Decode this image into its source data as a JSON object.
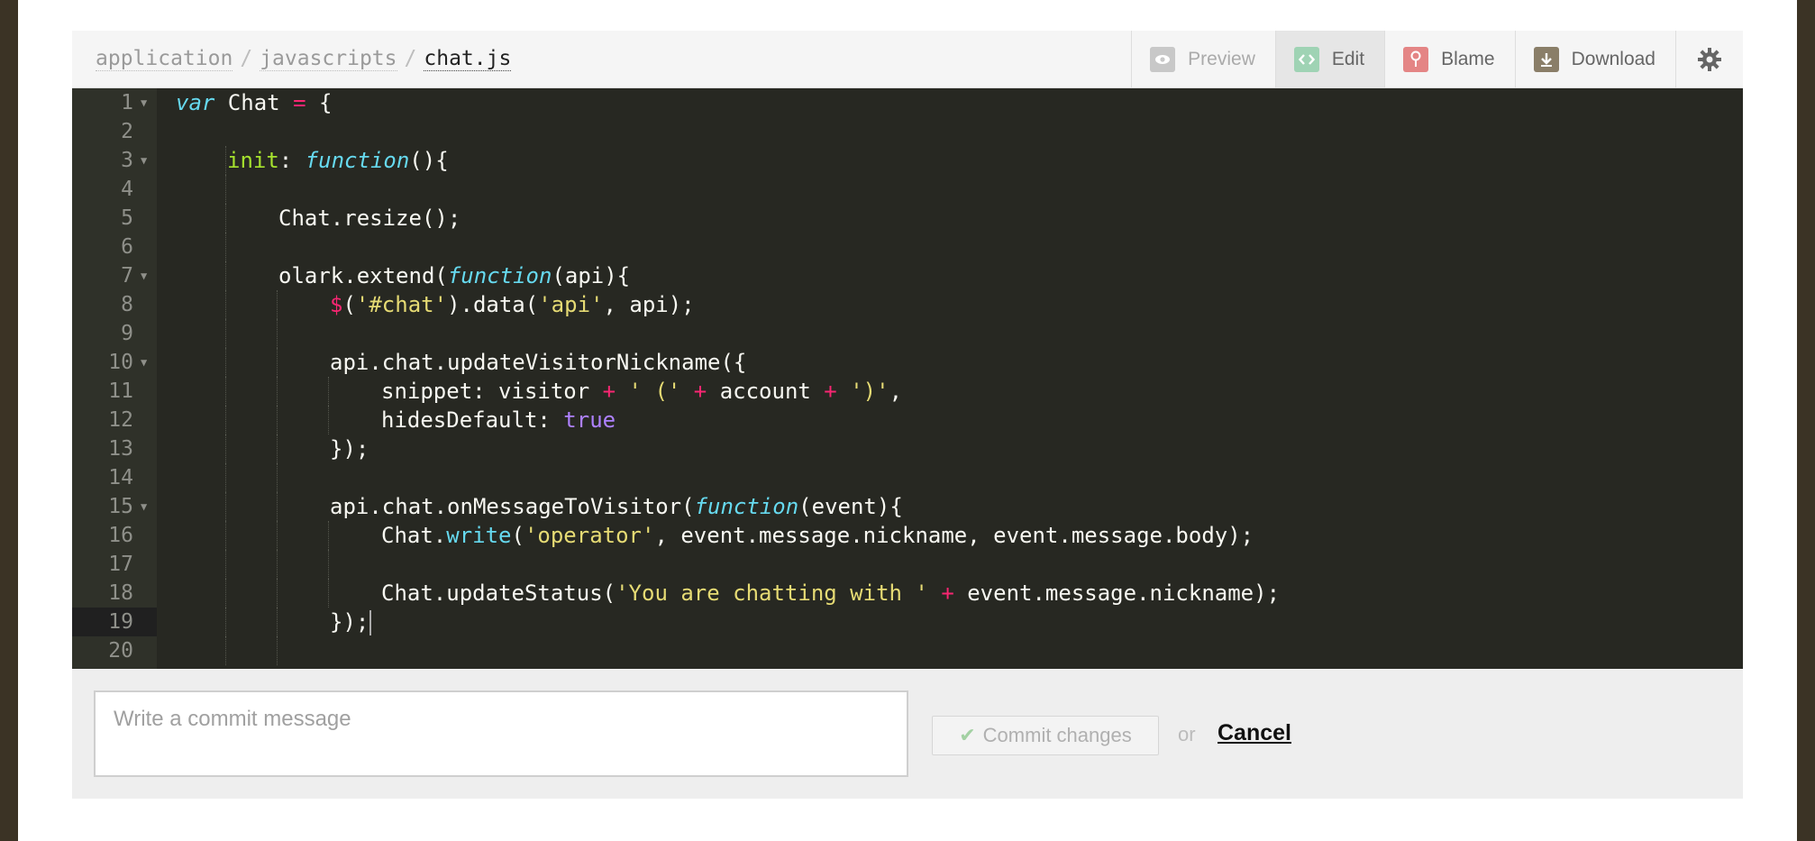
{
  "breadcrumb": {
    "parts": [
      "application",
      "javascripts"
    ],
    "separator": "/",
    "current": "chat.js"
  },
  "toolbar": {
    "preview_label": "Preview",
    "edit_label": "Edit",
    "blame_label": "Blame",
    "download_label": "Download",
    "icons": {
      "preview": "eye-icon",
      "edit": "code-icon",
      "blame": "pin-icon",
      "download": "download-icon",
      "settings": "gear-icon"
    },
    "colors": {
      "preview_icon": "#c8c8c8",
      "edit_icon": "#9fd3b4",
      "blame_icon": "#e48585",
      "download_icon": "#8a7e68"
    }
  },
  "editor": {
    "active_line": 19,
    "colors": {
      "background": "#272822",
      "gutter": "#2f3129",
      "keyword": "#66d9ef",
      "operator": "#f92672",
      "string": "#e6db74",
      "property": "#a6e22e",
      "boolean": "#ae81ff"
    },
    "lines": [
      {
        "n": "1",
        "fold": true,
        "indent": 0,
        "tokens": [
          [
            "var",
            "k-var"
          ],
          [
            " Chat ",
            ""
          ],
          [
            "=",
            "k-op"
          ],
          [
            " {",
            ""
          ]
        ]
      },
      {
        "n": "2",
        "fold": false,
        "indent": 0,
        "tokens": []
      },
      {
        "n": "3",
        "fold": true,
        "indent": 1,
        "tokens": [
          [
            "init",
            "k-prop"
          ],
          [
            ": ",
            ""
          ],
          [
            "function",
            "k-fn"
          ],
          [
            "(){",
            ""
          ]
        ]
      },
      {
        "n": "4",
        "fold": false,
        "indent": 0,
        "tokens": []
      },
      {
        "n": "5",
        "fold": false,
        "indent": 2,
        "tokens": [
          [
            "Chat.resize();",
            ""
          ]
        ]
      },
      {
        "n": "6",
        "fold": false,
        "indent": 0,
        "tokens": []
      },
      {
        "n": "7",
        "fold": true,
        "indent": 2,
        "tokens": [
          [
            "olark.extend(",
            ""
          ],
          [
            "function",
            "k-fn"
          ],
          [
            "(api){",
            ""
          ]
        ]
      },
      {
        "n": "8",
        "fold": false,
        "indent": 3,
        "tokens": [
          [
            "$",
            "k-op"
          ],
          [
            "(",
            ""
          ],
          [
            "'#chat'",
            "k-str"
          ],
          [
            ").data(",
            ""
          ],
          [
            "'api'",
            "k-str"
          ],
          [
            ", api);",
            ""
          ]
        ]
      },
      {
        "n": "9",
        "fold": false,
        "indent": 0,
        "tokens": []
      },
      {
        "n": "10",
        "fold": true,
        "indent": 3,
        "tokens": [
          [
            "api.chat.updateVisitorNickname({",
            ""
          ]
        ]
      },
      {
        "n": "11",
        "fold": false,
        "indent": 4,
        "tokens": [
          [
            "snippet: visitor ",
            ""
          ],
          [
            "+",
            "k-op"
          ],
          [
            " ",
            ""
          ],
          [
            "' ('",
            "k-str"
          ],
          [
            " ",
            ""
          ],
          [
            "+",
            "k-op"
          ],
          [
            " account ",
            ""
          ],
          [
            "+",
            "k-op"
          ],
          [
            " ",
            ""
          ],
          [
            "')'",
            "k-str"
          ],
          [
            ",",
            ""
          ]
        ]
      },
      {
        "n": "12",
        "fold": false,
        "indent": 4,
        "tokens": [
          [
            "hidesDefault: ",
            ""
          ],
          [
            "true",
            "k-bool"
          ]
        ]
      },
      {
        "n": "13",
        "fold": false,
        "indent": 3,
        "tokens": [
          [
            "});",
            ""
          ]
        ]
      },
      {
        "n": "14",
        "fold": false,
        "indent": 0,
        "tokens": []
      },
      {
        "n": "15",
        "fold": true,
        "indent": 3,
        "tokens": [
          [
            "api.chat.onMessageToVisitor(",
            ""
          ],
          [
            "function",
            "k-fn"
          ],
          [
            "(event){",
            ""
          ]
        ]
      },
      {
        "n": "16",
        "fold": false,
        "indent": 4,
        "tokens": [
          [
            "Chat.",
            ""
          ],
          [
            "write",
            "k-method"
          ],
          [
            "(",
            ""
          ],
          [
            "'operator'",
            "k-str"
          ],
          [
            ", event.message.nickname, event.message.body);",
            ""
          ]
        ]
      },
      {
        "n": "17",
        "fold": false,
        "indent": 0,
        "tokens": []
      },
      {
        "n": "18",
        "fold": false,
        "indent": 4,
        "tokens": [
          [
            "Chat.updateStatus(",
            ""
          ],
          [
            "'You are chatting with '",
            "k-str"
          ],
          [
            " ",
            ""
          ],
          [
            "+",
            "k-op"
          ],
          [
            " event.message.nickname);",
            ""
          ]
        ]
      },
      {
        "n": "19",
        "fold": false,
        "indent": 3,
        "tokens": [
          [
            "});",
            ""
          ]
        ]
      },
      {
        "n": "20",
        "fold": false,
        "indent": 0,
        "tokens": []
      }
    ]
  },
  "commit": {
    "placeholder": "Write a commit message",
    "value": "",
    "button_label": "Commit changes",
    "or_label": "or",
    "cancel_label": "Cancel"
  }
}
